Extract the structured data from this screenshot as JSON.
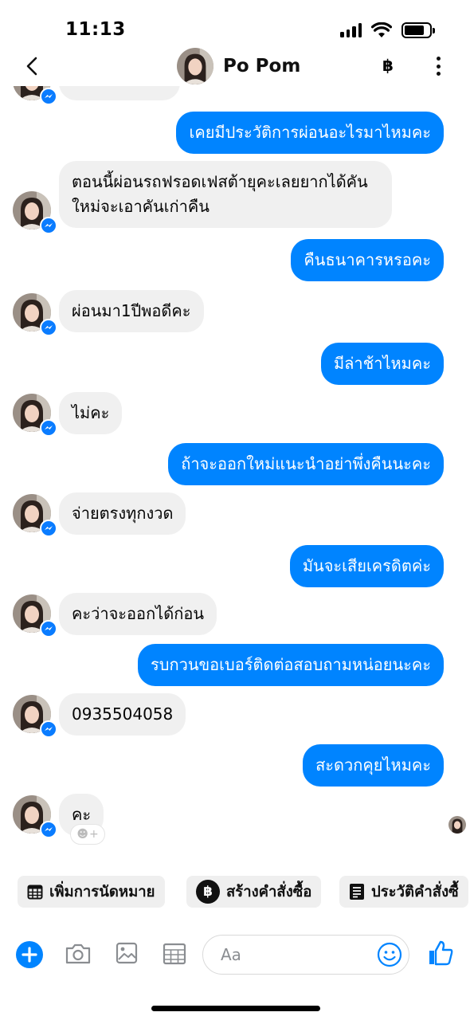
{
  "status": {
    "time": "11:13"
  },
  "header": {
    "name": "Po Pom",
    "baht": "฿"
  },
  "messages": [
    {
      "dir": "out",
      "text": "เคยมีประวัติการผ่อนอะไรมาไหมคะ"
    },
    {
      "dir": "in",
      "text": "ตอนนี้ผ่อนรถฟรอดเฟสต้ายุคะเลยยากได้คันใหม่จะเอาคันเก่าคืน"
    },
    {
      "dir": "out",
      "text": "คืนธนาคารหรอคะ"
    },
    {
      "dir": "in",
      "text": "ผ่อนมา1ปีพอดีคะ"
    },
    {
      "dir": "out",
      "text": "มีล่าช้าไหมคะ"
    },
    {
      "dir": "in",
      "text": "ไม่คะ"
    },
    {
      "dir": "out",
      "text": "ถ้าจะออกใหม่แนะนำอย่าพึ่งคืนนะคะ"
    },
    {
      "dir": "in",
      "text": "จ่ายตรงทุกงวด"
    },
    {
      "dir": "out",
      "text": "มันจะเสียเครดิตค่ะ"
    },
    {
      "dir": "in",
      "text": "คะว่าจะออกได้ก่อน"
    },
    {
      "dir": "out",
      "text": "รบกวนขอเบอร์ติดต่อสอบถามหน่อยนะคะ"
    },
    {
      "dir": "in",
      "text": "0935504058"
    },
    {
      "dir": "out",
      "text": "สะดวกคุยไหมคะ"
    },
    {
      "dir": "in",
      "text": "คะ"
    }
  ],
  "quick_actions": [
    {
      "label": "เพิ่มการนัดหมาย",
      "icon": "calendar-icon"
    },
    {
      "label": "สร้างคำสั่งซื้อ",
      "icon": "baht-icon"
    },
    {
      "label": "ประวัติคำสั่งซื้",
      "icon": "receipt-icon"
    }
  ],
  "composer": {
    "placeholder": "Aa"
  },
  "colors": {
    "accent": "#0084ff",
    "incoming_bubble": "#f0f0f0"
  }
}
